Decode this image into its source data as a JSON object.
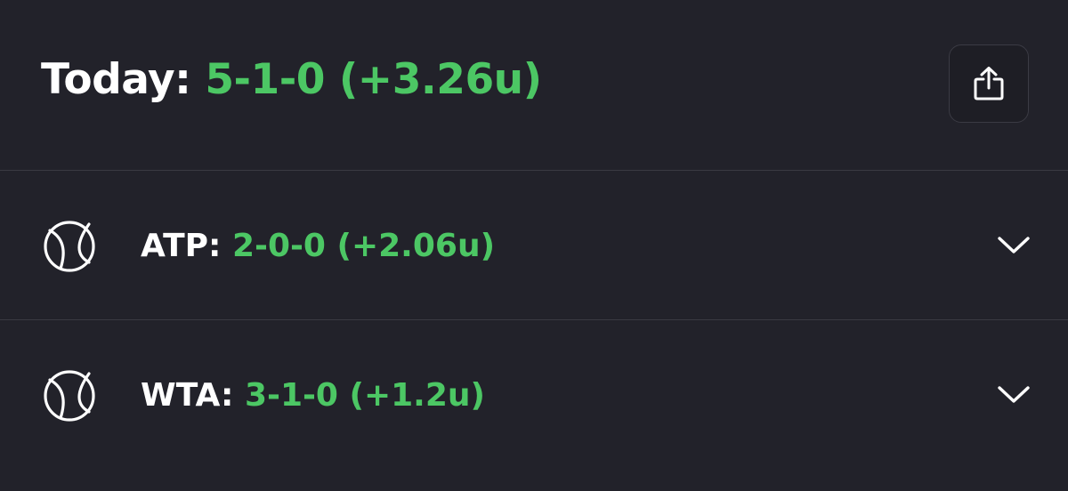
{
  "header": {
    "label": "Today:",
    "record": "5-1-0 (+3.26u)"
  },
  "share_button": {
    "icon": "share-icon"
  },
  "sections": [
    {
      "label": "ATP:",
      "record": "2-0-0 (+2.06u)",
      "icon": "tennis-ball-icon",
      "expand_icon": "chevron-down-icon"
    },
    {
      "label": "WTA:",
      "record": "3-1-0 (+1.2u)",
      "icon": "tennis-ball-icon",
      "expand_icon": "chevron-down-icon"
    }
  ],
  "colors": {
    "background": "#22222a",
    "accent_green": "#4cc764",
    "divider": "#3a3a42"
  }
}
